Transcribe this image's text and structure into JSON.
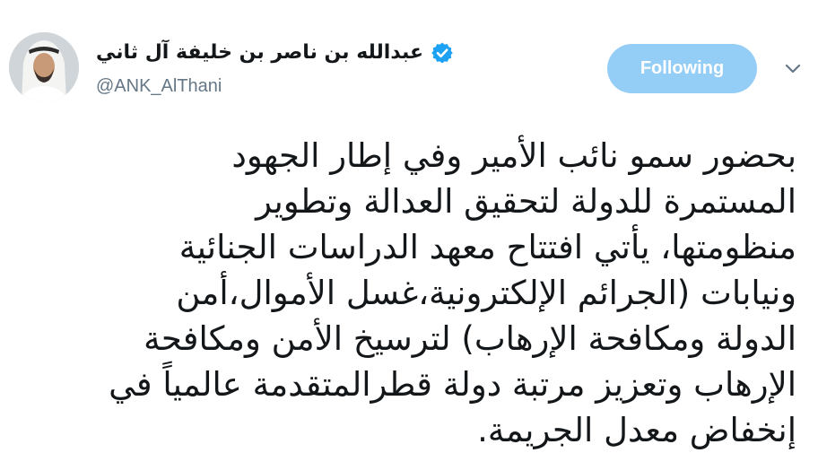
{
  "tweet": {
    "author": {
      "display_name": "عبدالله بن ناصر بن خليفة آل ثاني",
      "handle": "@ANK_AlThani",
      "verified": true,
      "verified_icon": "verified-badge-icon",
      "avatar_icon": "profile-photo"
    },
    "follow_button": {
      "label": "Following"
    },
    "more_menu_icon": "chevron-down-icon",
    "text_lines": [
      "بحضور سمو نائب الأمير وفي إطار الجهود",
      "المستمرة للدولة لتحقيق العدالة وتطوير",
      "منظومتها، يأتي افتتاح معهد الدراسات الجنائية",
      "ونيابات (الجرائم الإلكترونية،غسل الأموال،أمن",
      "الدولة ومكافحة الإرهاب) لترسيخ الأمن ومكافحة",
      "الإرهاب وتعزيز مرتبة دولة قطرالمتقدمة عالمياً في",
      "إنخفاض معدل الجريمة."
    ]
  },
  "colors": {
    "follow_button_bg": "#94cdf6",
    "verified_blue": "#1da1f2",
    "handle_gray": "#657786",
    "text_dark": "#14171a"
  }
}
